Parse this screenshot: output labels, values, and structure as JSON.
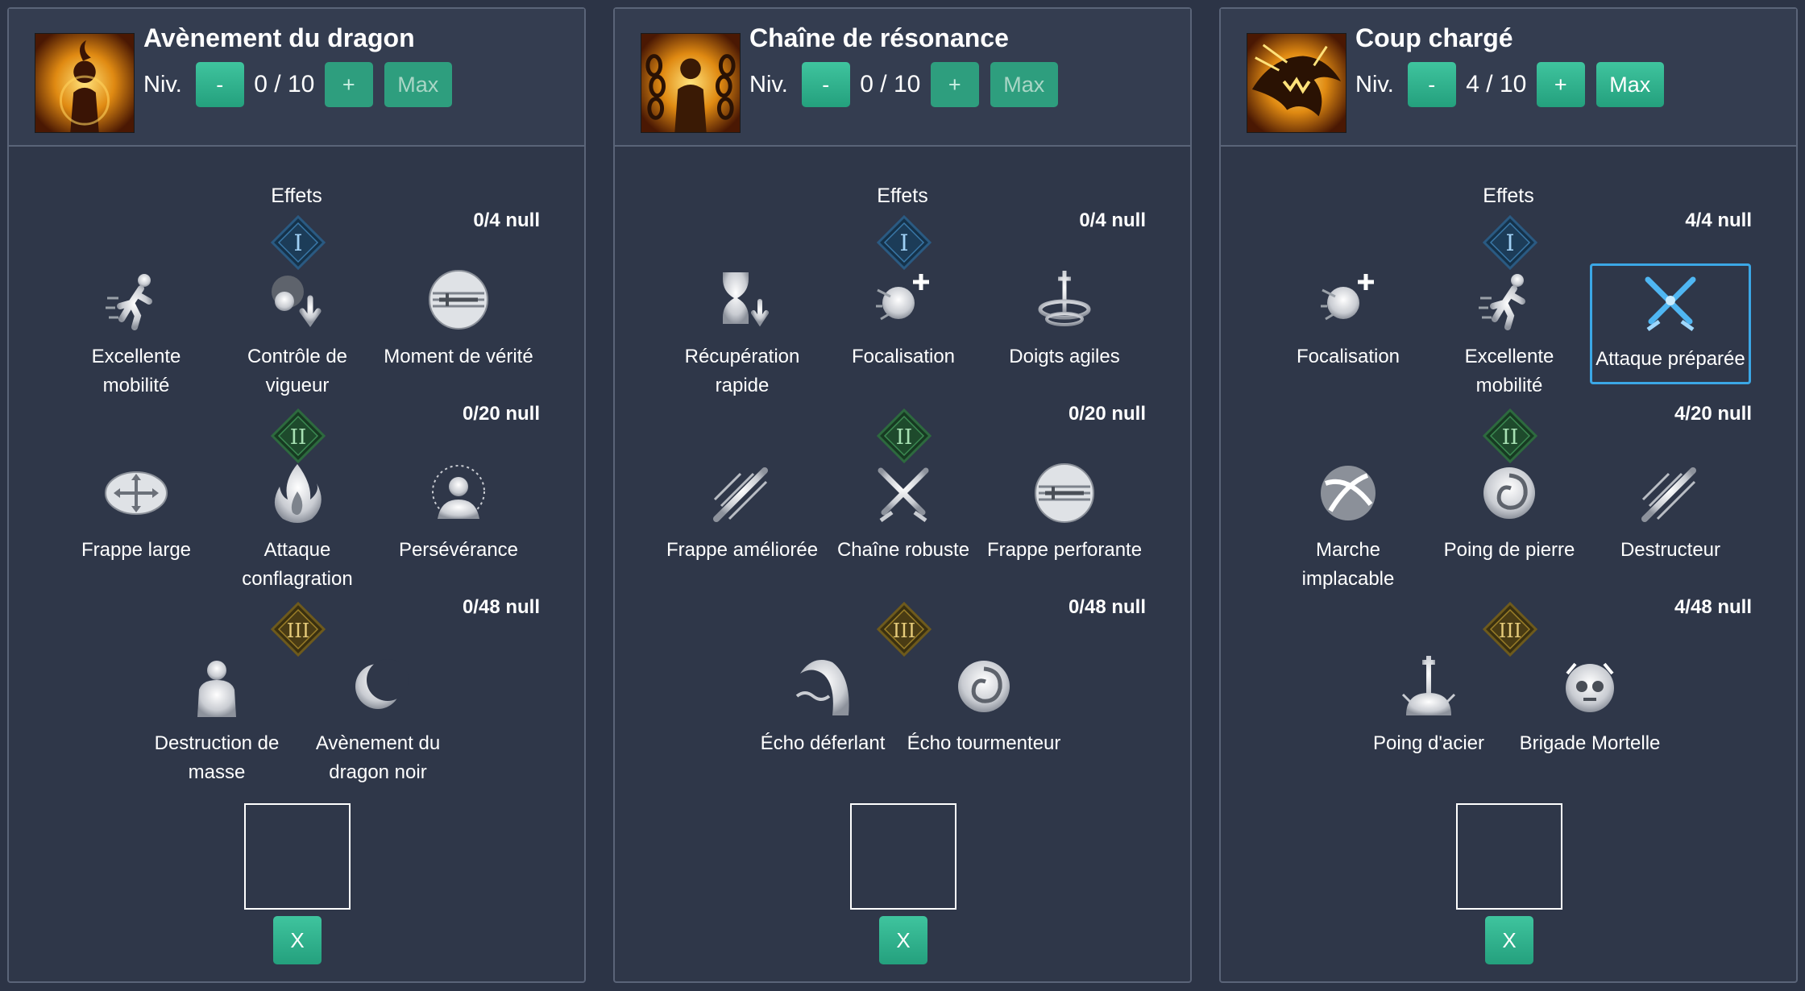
{
  "colors": {
    "background": "#2c3446",
    "panel_border": "#5a6478",
    "button_green": "#2fb38e",
    "selected_border": "#3ba7e6"
  },
  "panels": [
    {
      "title": "Avènement du dragon",
      "level_label": "Niv.",
      "level_current": "0",
      "level_sep": "/",
      "level_max": "10",
      "minus_label": "-",
      "plus_label": "+",
      "max_label": "Max",
      "effects_label": "Effets",
      "tiers": [
        {
          "numeral": "I",
          "count": "0/4 null",
          "nodes": [
            {
              "label": "Excellente mobilité",
              "icon": "running-figure-icon"
            },
            {
              "label": "Contrôle de vigueur",
              "icon": "vigor-control-icon"
            },
            {
              "label": "Moment de vérité",
              "icon": "sword-circle-icon"
            }
          ]
        },
        {
          "numeral": "II",
          "count": "0/20 null",
          "nodes": [
            {
              "label": "Frappe large",
              "icon": "wide-strike-icon"
            },
            {
              "label": "Attaque conflagration",
              "icon": "flame-icon"
            },
            {
              "label": "Persévérance",
              "icon": "perseverance-icon"
            }
          ]
        },
        {
          "numeral": "III",
          "count": "0/48 null",
          "nodes": [
            {
              "label": "Destruction de masse",
              "icon": "bust-figure-icon"
            },
            {
              "label": "Avènement du dragon noir",
              "icon": "crescent-moon-icon"
            }
          ]
        }
      ],
      "close_label": "X"
    },
    {
      "title": "Chaîne de résonance",
      "level_label": "Niv.",
      "level_current": "0",
      "level_sep": "/",
      "level_max": "10",
      "minus_label": "-",
      "plus_label": "+",
      "max_label": "Max",
      "effects_label": "Effets",
      "tiers": [
        {
          "numeral": "I",
          "count": "0/4 null",
          "nodes": [
            {
              "label": "Récupération rapide",
              "icon": "hourglass-icon"
            },
            {
              "label": "Focalisation",
              "icon": "focus-orb-icon"
            },
            {
              "label": "Doigts agiles",
              "icon": "agile-fingers-icon"
            }
          ]
        },
        {
          "numeral": "II",
          "count": "0/20 null",
          "nodes": [
            {
              "label": "Frappe améliorée",
              "icon": "slash-strike-icon"
            },
            {
              "label": "Chaîne robuste",
              "icon": "crossed-swords-icon"
            },
            {
              "label": "Frappe perforante",
              "icon": "sword-circle-icon"
            }
          ]
        },
        {
          "numeral": "III",
          "count": "0/48 null",
          "nodes": [
            {
              "label": "Écho déferlant",
              "icon": "wave-icon"
            },
            {
              "label": "Écho tourmenteur",
              "icon": "vortex-icon"
            }
          ]
        }
      ],
      "close_label": "X"
    },
    {
      "title": "Coup chargé",
      "level_label": "Niv.",
      "level_current": "4",
      "level_sep": "/",
      "level_max": "10",
      "minus_label": "-",
      "plus_label": "+",
      "max_label": "Max",
      "effects_label": "Effets",
      "tiers": [
        {
          "numeral": "I",
          "count": "4/4 null",
          "nodes": [
            {
              "label": "Focalisation",
              "icon": "focus-orb-icon"
            },
            {
              "label": "Excellente mobilité",
              "icon": "running-figure-icon"
            },
            {
              "label": "Attaque préparée",
              "icon": "crossed-swords-blue-icon",
              "selected": true
            }
          ]
        },
        {
          "numeral": "II",
          "count": "4/20 null",
          "nodes": [
            {
              "label": "Marche implacable",
              "icon": "relentless-march-icon"
            },
            {
              "label": "Poing de pierre",
              "icon": "vortex-icon"
            },
            {
              "label": "Destructeur",
              "icon": "slash-strike-icon"
            }
          ]
        },
        {
          "numeral": "III",
          "count": "4/48 null",
          "nodes": [
            {
              "label": "Poing d'acier",
              "icon": "steel-fist-icon"
            },
            {
              "label": "Brigade Mortelle",
              "icon": "skull-icon"
            }
          ]
        }
      ],
      "close_label": "X"
    }
  ]
}
